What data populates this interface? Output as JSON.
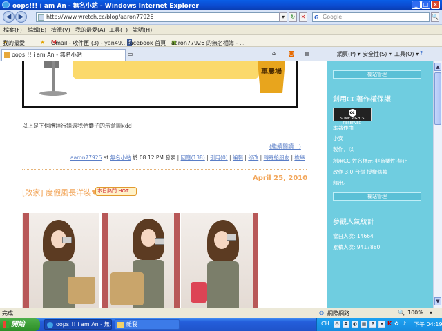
{
  "window": {
    "title": "oops!!! i am An - 無名小站 - Windows Internet Explorer",
    "minimize": "_",
    "maximize": "□",
    "close": "×"
  },
  "address": {
    "url": "http://www.wretch.cc/blog/aaron77926",
    "search_placeholder": "Google",
    "search_logo": "G"
  },
  "menu": [
    "檔案(F)",
    "編輯(E)",
    "檢視(V)",
    "我的最愛(A)",
    "工具(T)",
    "說明(H)"
  ],
  "favorites": {
    "label": "我的最愛",
    "items": [
      "Gmail - 收件匣 (3) - yan49...",
      "Facebook 首頁",
      "aaron77926 的無名相簿 - ..."
    ]
  },
  "tabs": {
    "active": "oops!!! i am An - 無名小站",
    "tools": [
      "網頁(P) ▾",
      "安全性(S) ▾",
      "工具(O) ▾"
    ]
  },
  "post1": {
    "text": "以上是下個禮拜行銷週我們攤子的示意圖xdd",
    "more": "(繼續閱讀...)",
    "author": "aaron77926",
    "at": " at ",
    "site": "無名小站",
    "time": " 於 08:12 PM 發表 | ",
    "links": [
      "回應(138)",
      "引用(0)",
      "編輯",
      "修改",
      "轉寄給朋友",
      "檢舉"
    ]
  },
  "post2": {
    "date": "April 25, 2010",
    "title": "[敗家] 度假風長洋裝♥",
    "badge": "本日熱門 HOT"
  },
  "banner": {
    "tag": "車農場"
  },
  "sidebar": {
    "head1": "欄站管理",
    "cc_title": "創用CC著作權保護",
    "cc_badge_top": "cc",
    "cc_badge_text": "SOME RIGHTS RESERVED",
    "cc_lines": [
      "本著作由",
      "小安",
      "製作，以",
      "創用CC 姓名標示-非商業性-禁止",
      "改作 3.0 台灣 授權條款",
      "釋出。"
    ],
    "head2": "欄站管理",
    "stats_title": "參觀人氣統計",
    "today": "當日人次: 14664",
    "total": "累積人次: 9417880"
  },
  "status": {
    "left": "完成",
    "zone": "網際網路",
    "zoom": "100%"
  },
  "taskbar": {
    "start": "開始",
    "tasks": [
      "oops!!! i am An - 無...",
      "雜我"
    ],
    "lang": "CH",
    "clock": "下午 04:19"
  }
}
